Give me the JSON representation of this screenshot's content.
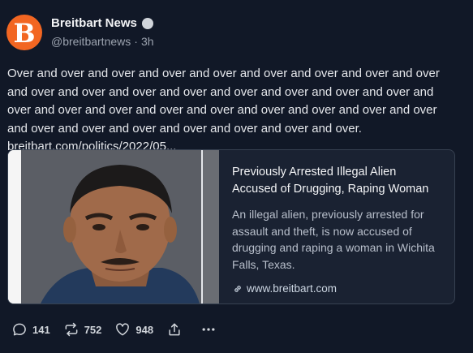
{
  "post": {
    "author": {
      "display_name": "Breitbart News",
      "handle": "@breitbartnews",
      "separator": "·",
      "time": "3h",
      "avatar_letter": "B",
      "avatar_color": "#f26622"
    },
    "text": "Over and over and over and over and over and over and over and over and over and over and over and over and over and over and over and over and over and over and over and over and over and over and over and over and over and over and over and over and over and over and over and over and over.",
    "link_text": "breitbart.com/politics/2022/05..."
  },
  "card": {
    "title": "Previously Arrested Illegal Alien Accused of Drugging, Raping Woman",
    "description": "An illegal alien, previously arrested for assault and theft, is now accused of drugging and raping a woman in Wichita Falls, Texas.",
    "domain": "www.breitbart.com",
    "link_icon": "link-icon"
  },
  "actions": {
    "reply_count": "141",
    "repost_count": "752",
    "like_count": "948",
    "reply_icon": "reply-icon",
    "repost_icon": "repost-icon",
    "like_icon": "heart-icon",
    "share_icon": "share-icon",
    "more_icon": "more-icon"
  },
  "colors": {
    "background": "#111827",
    "card_border": "#374151",
    "text": "#e5e7eb",
    "muted": "#9ca3af"
  }
}
